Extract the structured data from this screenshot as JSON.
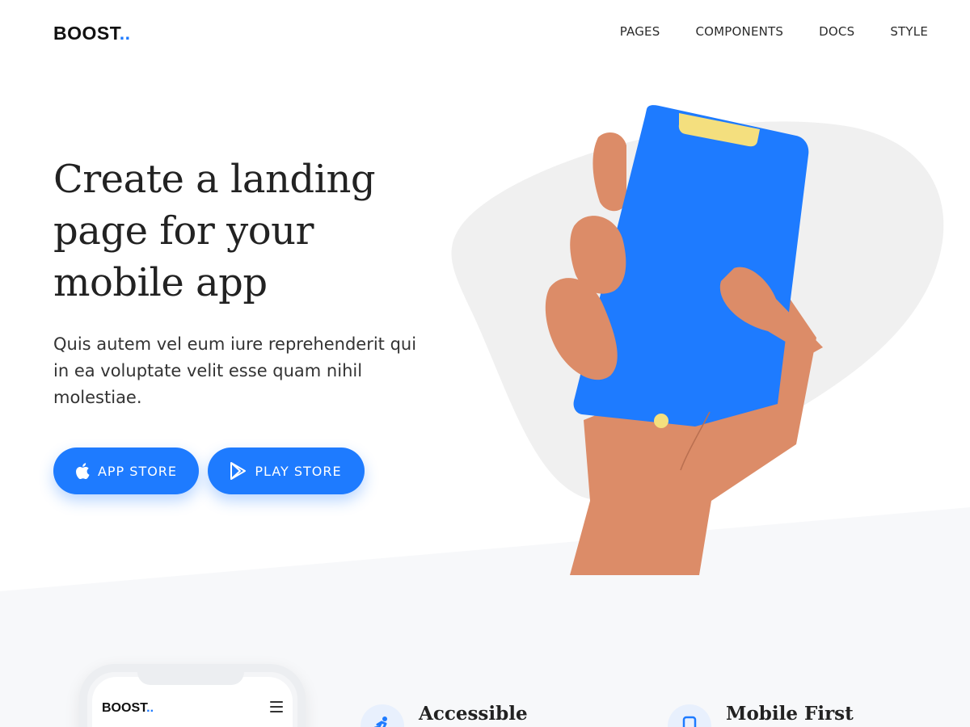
{
  "header": {
    "logo_text": "BOOST",
    "logo_dots": "..",
    "nav": [
      "PAGES",
      "COMPONENTS",
      "DOCS",
      "STYLE"
    ]
  },
  "hero": {
    "title": "Create a landing page for your mobile app",
    "subtitle": "Quis autem vel eum iure reprehenderit qui in ea voluptate velit esse quam nihil molestiae.",
    "buttons": [
      {
        "label": "APP STORE",
        "icon": "apple-icon"
      },
      {
        "label": "PLAY STORE",
        "icon": "play-store-icon"
      }
    ]
  },
  "mockup": {
    "logo_text": "BOOST",
    "logo_dots": "..",
    "menu_icon": "hamburger-menu-icon"
  },
  "features": [
    {
      "title": "Accessible",
      "icon": "running-person-icon"
    },
    {
      "title": "Mobile First",
      "icon": "mobile-phone-icon"
    }
  ],
  "colors": {
    "accent": "#1e7bff",
    "skin": "#dc8c68",
    "blob": "#f0f0f0",
    "notch": "#f4df7e",
    "section_bg": "#f7f8fa"
  }
}
